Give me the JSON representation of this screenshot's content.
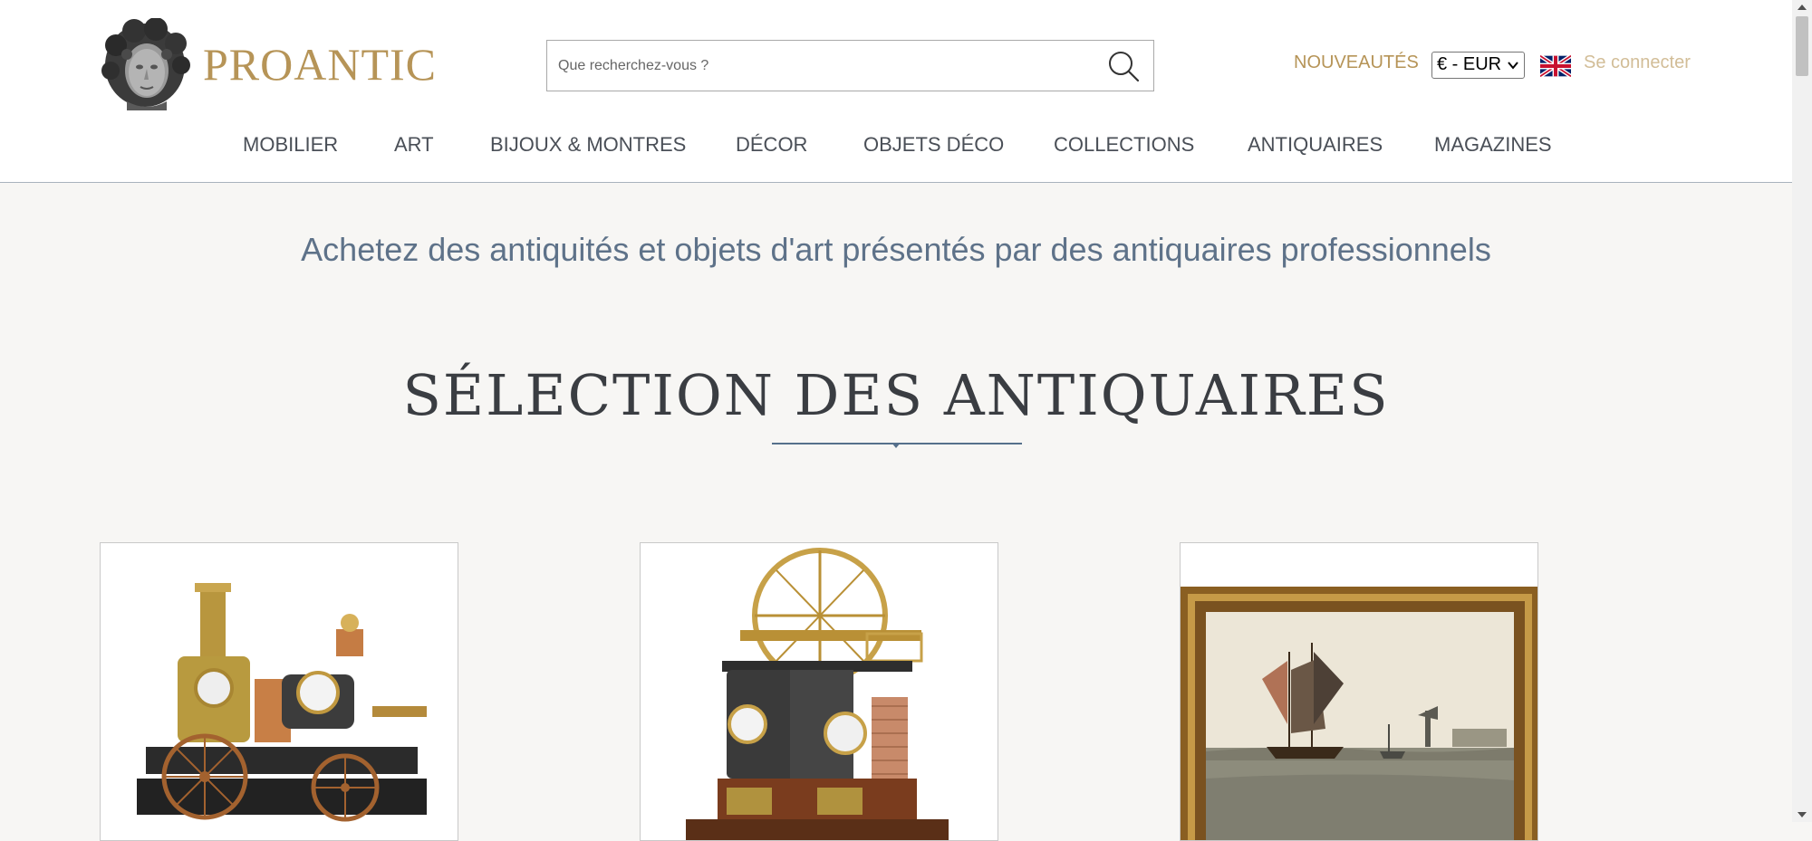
{
  "brand": {
    "name": "PROANTIC"
  },
  "search": {
    "placeholder": "Que recherchez-vous ?"
  },
  "top_links": {
    "nouveautes": "NOUVEAUTÉS",
    "currency": "€ - EUR",
    "login": "Se connecter"
  },
  "nav": [
    "MOBILIER",
    "ART",
    "BIJOUX & MONTRES",
    "DÉCOR",
    "OBJETS DÉCO",
    "COLLECTIONS",
    "ANTIQUAIRES",
    "MAGAZINES"
  ],
  "tagline": "Achetez des antiquités et objets d'art présentés par des antiquaires professionnels",
  "section": {
    "title": "SÉLECTION DES ANTIQUAIRES"
  },
  "icons": {
    "logo": "classical-bust-logo",
    "search": "magnifier-icon",
    "flag": "uk-flag-icon",
    "select_arrow": "chevron-down-icon"
  },
  "colors": {
    "brand_gold": "#b69457",
    "login_light_gold": "#d2bd97",
    "nav_text": "#4a4f57",
    "tagline_blue": "#5e7289",
    "title_rule": "#56708b",
    "page_background": "#f7f6f4"
  },
  "cards": [
    {
      "subject": "steam fire engine clock"
    },
    {
      "subject": "beam engine industrial clock"
    },
    {
      "subject": "framed marine painting with sailing ships"
    }
  ]
}
